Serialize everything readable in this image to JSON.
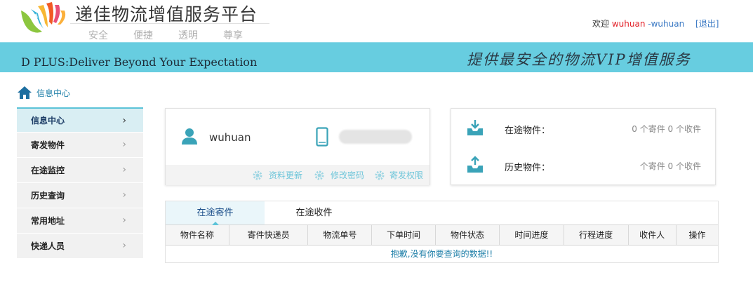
{
  "header": {
    "site_title": "递佳物流增值服务平台",
    "slogans": [
      "安全",
      "便捷",
      "透明",
      "尊享"
    ],
    "welcome": "欢迎",
    "username": "wuhuan",
    "username_suffix": "-wuhuan",
    "logout": "[退出]"
  },
  "banner": {
    "tagline": "D PLUS:Deliver Beyond Your Expectation",
    "slogan": "提供最安全的物流VIP增值服务"
  },
  "breadcrumb": {
    "label": "信息中心"
  },
  "sidebar": {
    "items": [
      {
        "label": "信息中心",
        "active": true
      },
      {
        "label": "寄发物件"
      },
      {
        "label": "在途监控"
      },
      {
        "label": "历史查询"
      },
      {
        "label": "常用地址"
      },
      {
        "label": "快递人员"
      }
    ]
  },
  "user_card": {
    "name": "wuhuan",
    "links": [
      "资料更新",
      "修改密码",
      "寄发权限"
    ]
  },
  "stats": {
    "in_transit_label": "在途物件：",
    "in_transit_value": "0 个寄件 0 个收件",
    "history_label": "历史物件：",
    "history_value": "个寄件 0 个收件"
  },
  "table": {
    "tabs": [
      "在途寄件",
      "在途收件"
    ],
    "columns": [
      "物件名称",
      "寄件快递员",
      "物流单号",
      "下单时间",
      "物件状态",
      "时间进度",
      "行程进度",
      "收件人",
      "操作"
    ],
    "empty_message": "抱歉,没有你要查询的数据!!"
  },
  "colors": {
    "banner": "#67cde0",
    "accent": "#5cc3d8",
    "link": "#1e7fa8",
    "username": "#e3242b"
  }
}
